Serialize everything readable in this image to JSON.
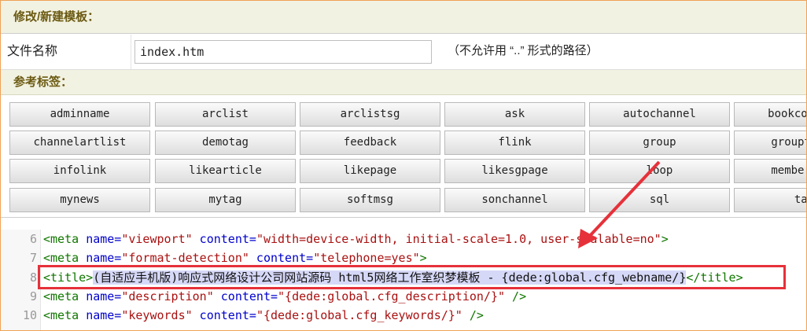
{
  "section_edit": {
    "title": "修改/新建模板："
  },
  "file": {
    "label": "文件名称",
    "value": "index.htm",
    "hint": "（不允许用 “..” 形式的路径）"
  },
  "section_tags": {
    "title": "参考标签："
  },
  "tags": [
    [
      "adminname",
      "arclist",
      "arclistsg",
      "ask",
      "autochannel",
      "bookcontent"
    ],
    [
      "channelartlist",
      "demotag",
      "feedback",
      "flink",
      "group",
      "grouptheme"
    ],
    [
      "infolink",
      "likearticle",
      "likepage",
      "likesgpage",
      "loop",
      "memberlist"
    ],
    [
      "mynews",
      "mytag",
      "softmsg",
      "sonchannel",
      "sql",
      "tag"
    ]
  ],
  "code_lines": [
    {
      "num": "6",
      "parts": [
        {
          "c": "tg",
          "t": "<meta "
        },
        {
          "c": "at",
          "t": "name="
        },
        {
          "c": "sv",
          "t": "\"viewport\""
        },
        {
          "c": "at",
          "t": " content="
        },
        {
          "c": "sv",
          "t": "\"width=device-width, initial-scale=1.0, user-scalable=no\""
        },
        {
          "c": "tg",
          "t": ">"
        }
      ]
    },
    {
      "num": "7",
      "parts": [
        {
          "c": "tg",
          "t": "<meta "
        },
        {
          "c": "at",
          "t": "name="
        },
        {
          "c": "sv",
          "t": "\"format-detection\""
        },
        {
          "c": "at",
          "t": " content="
        },
        {
          "c": "sv",
          "t": "\"telephone=yes\""
        },
        {
          "c": "tg",
          "t": ">"
        }
      ]
    },
    {
      "num": "8",
      "parts": [
        {
          "c": "tg",
          "t": "<title>"
        },
        {
          "c": "tx hl",
          "t": "(自适应手机版)响应式网络设计公司网站源码 html5网络工作室织梦模板 - {dede:global.cfg_webname/}"
        },
        {
          "c": "tg",
          "t": "</title>"
        }
      ]
    },
    {
      "num": "9",
      "parts": [
        {
          "c": "tg",
          "t": "<meta "
        },
        {
          "c": "at",
          "t": "name="
        },
        {
          "c": "sv",
          "t": "\"description\""
        },
        {
          "c": "at",
          "t": " content="
        },
        {
          "c": "sv",
          "t": "\"{dede:global.cfg_description/}\""
        },
        {
          "c": "tg",
          "t": " />"
        }
      ]
    },
    {
      "num": "10",
      "parts": [
        {
          "c": "tg",
          "t": "<meta "
        },
        {
          "c": "at",
          "t": "name="
        },
        {
          "c": "sv",
          "t": "\"keywords\""
        },
        {
          "c": "at",
          "t": " content="
        },
        {
          "c": "sv",
          "t": "\"{dede:global.cfg_keywords/}\""
        },
        {
          "c": "tg",
          "t": " />"
        }
      ]
    }
  ]
}
